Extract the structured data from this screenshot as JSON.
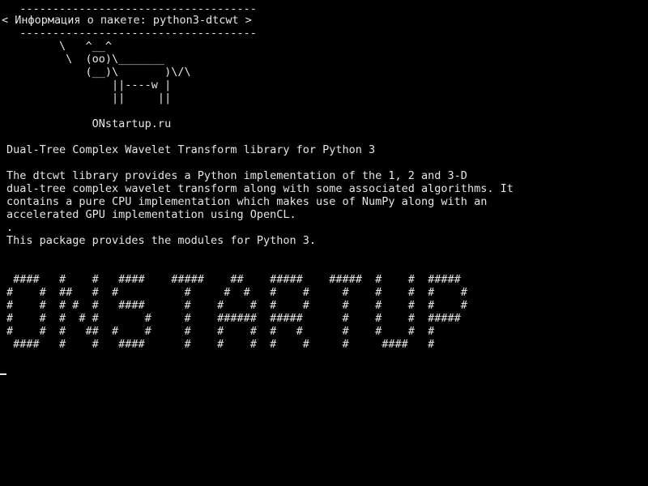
{
  "cowsay": {
    "top_border": "  ------------------------------------",
    "title_line": "< Информация о пакете: python3-dtcwt >",
    "bottom_border": "  ------------------------------------",
    "cow": [
      "        \\   ^__^",
      "         \\  (oo)\\_______",
      "            (__)\\       )\\/\\",
      "                ||----w |",
      "                ||     ||"
    ],
    "site": "             ONstartup.ru"
  },
  "package": {
    "summary": "Dual-Tree Complex Wavelet Transform library for Python 3",
    "description": [
      "The dtcwt library provides a Python implementation of the 1, 2 and 3-D",
      "dual-tree complex wavelet transform along with some associated algorithms. It",
      "contains a pure CPU implementation which makes use of NumPy along with an",
      "accelerated GPU implementation using OpenCL.",
      ".",
      "This package provides the modules for Python 3."
    ]
  },
  "banner": {
    "lines": [
      " ####   #    #   ####    #####    ##    #####    #####  #    #  #####",
      "#    #  ##   #  #          #     #  #   #    #     #    #    #  #    #",
      "#    #  # #  #   ####      #    #    #  #    #     #    #    #  #    #",
      "#    #  #  # #       #     #    ######  #####      #    #    #  #####",
      "#    #  #   ##  #    #     #    #    #  #   #      #    #    #  #",
      " ####   #    #   ####      #    #    #  #    #     #     ####   #"
    ]
  }
}
